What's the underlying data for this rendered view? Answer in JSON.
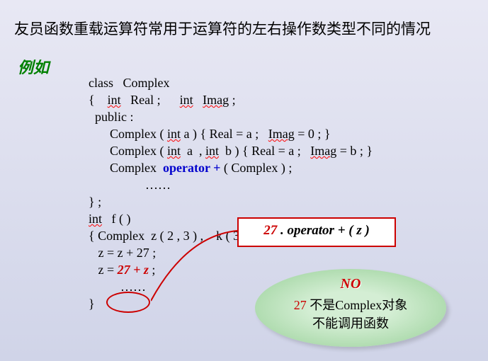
{
  "title": "友员函数重载运算符常用于运算符的左右操作数类型不同的情况",
  "example_label": "例如",
  "code": {
    "l01a": "class   Complex",
    "l02a": "{    ",
    "l02b": "int",
    "l02c": "   Real ;      ",
    "l02d": "int",
    "l02e": "   ",
    "l02f": "Imag",
    "l02g": " ;",
    "l03a": "  public :",
    "l04a": "Complex ( ",
    "l04b": "int",
    "l04c": " a ) { Real = a ;   ",
    "l04d": "Imag",
    "l04e": " = 0 ; }",
    "l05a": "Complex ( ",
    "l05b": "int",
    "l05c": "  a  , ",
    "l05d": "int",
    "l05e": "  b ) { Real = a ;   ",
    "l05f": "Imag",
    "l05g": " = b ; }",
    "l06a": "Complex  ",
    "l06b": "operator +",
    "l06c": " ( Complex ) ;",
    "l07a": "……",
    "l08a": "} ;",
    "l09a": "int",
    "l09b": "   f ( )",
    "l10a": "{ Complex  z ( 2 , 3 ) ,    k ( 3 , 4 ) ;",
    "l11a": "   z = z + 27 ;",
    "l12a": "   z = ",
    "l12b": "27 + z",
    "l12c": " ;",
    "l13a": "……",
    "l14a": "}"
  },
  "callout": {
    "num": "27",
    "rest": " . operator + ( z )"
  },
  "no_box": {
    "no": "NO",
    "n27": "27",
    "line2_rest": " 不是Complex对象",
    "line3": "不能调用函数"
  }
}
